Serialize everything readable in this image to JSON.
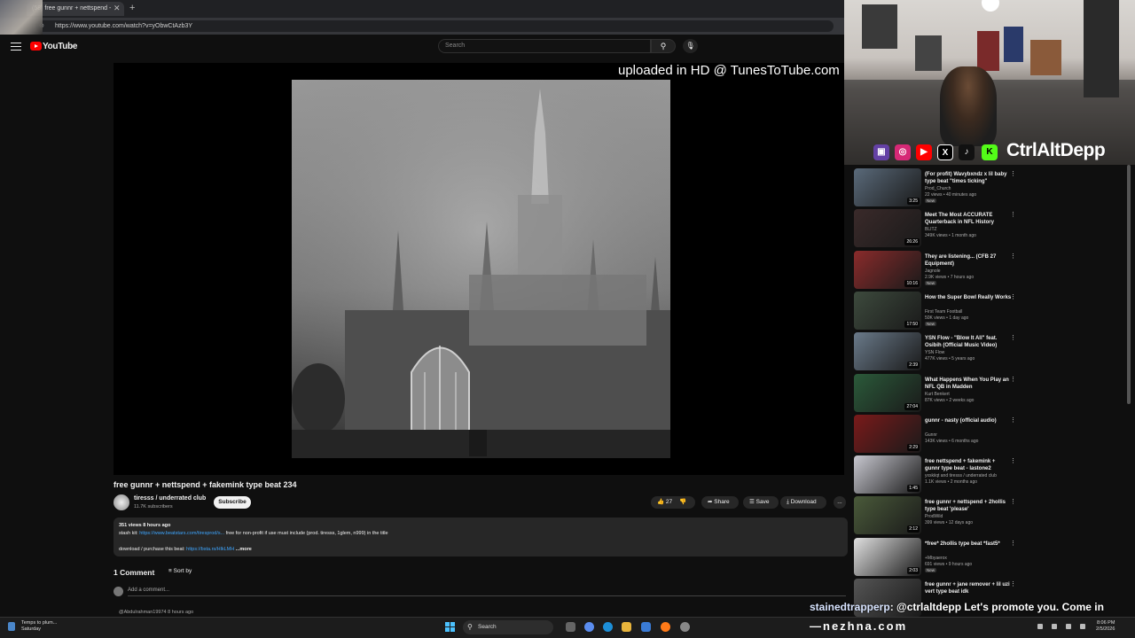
{
  "browser": {
    "tab_title": "(58) free gunnr + nettspend - ",
    "url": "https://www.youtube.com/watch?v=yObwCtAzb3Y"
  },
  "header": {
    "logo_text": "YouTube",
    "search_placeholder": "Search"
  },
  "player": {
    "watermark": "uploaded in HD @ TunesToTube.com"
  },
  "video": {
    "title": "free gunnr + nettspend + fakemink type beat 234",
    "channel_name": "tiresss / underrated club",
    "subscribers": "11.7K subscribers",
    "subscribe_label": "Subscribe",
    "likes": "27",
    "share_label": "Share",
    "save_label": "Save",
    "download_label": "Download",
    "more_label": "...",
    "description": {
      "views_time": "351 views  8 hours ago",
      "line1_prefix": "stash kit: ",
      "line1_link": "https://www.beatstars.com/tiresprod/s...",
      "line1_suffix": " free for non-profit if use must include (prod. tiresss, 1glem, n999) in the title",
      "line2_prefix": "download / purchase this beat: ",
      "line2_link": "https://bsta.rs/HlkLMH",
      "line2_more": " ...more"
    }
  },
  "comments": {
    "count_label": "1 Comment",
    "sort_label": "Sort by",
    "add_placeholder": "Add a comment...",
    "first_comment_author": "@Abdulrahman19974  8 hours ago"
  },
  "stream_overlay": {
    "streamer": "CtrlAltDepp",
    "chat_user": "stainedtrapperp",
    "chat_message": ": @ctrlaltdepp Let's promote you. Come in",
    "site": "—nezhna.com",
    "social_icons": [
      "twitch-icon",
      "instagram-icon",
      "youtube-icon",
      "x-icon",
      "tiktok-icon",
      "kick-icon"
    ]
  },
  "sidebar": {
    "items": [
      {
        "title": "(For profit) Wavybxndz x lil baby type beat \"times ticking\"",
        "channel": "Prod_Church",
        "meta": "22 views • 40 minutes ago",
        "badge": "New",
        "duration": "3:25",
        "thumb": "#5a6a7a"
      },
      {
        "title": "Meet The Most ACCURATE Quarterback in NFL History",
        "channel": "BLITZ",
        "meta": "349K views • 1 month ago",
        "badge": "",
        "duration": "26:26",
        "thumb": "#3a2a2a"
      },
      {
        "title": "They are listening... (CFB 27 Equipment)",
        "channel": "Jagnole",
        "meta": "2.9K views • 7 hours ago",
        "badge": "New",
        "duration": "10:16",
        "thumb": "#8a2b2b"
      },
      {
        "title": "How the Super Bowl Really Works",
        "channel": "First Team Football",
        "meta": "50K views • 1 day ago",
        "badge": "New",
        "duration": "17:50",
        "thumb": "#3d4a3d"
      },
      {
        "title": "YSN Flow - \"Blow It All\" feat. Osibih (Official Music Video)",
        "channel": "YSN Flow",
        "meta": "477K views • 5 years ago",
        "badge": "",
        "duration": "2:39",
        "thumb": "#6a7a8a"
      },
      {
        "title": "What Happens When You Play an NFL QB in Madden",
        "channel": "Kurt Benkert",
        "meta": "87K views • 2 weeks ago",
        "badge": "",
        "duration": "27:04",
        "thumb": "#2b5a3a"
      },
      {
        "title": "gunnr - nasty (official audio)",
        "channel": "Gunnr",
        "meta": "143K views • 6 months ago",
        "badge": "",
        "duration": "2:29",
        "thumb": "#7a1a1a"
      },
      {
        "title": "free nettspend + fakemink + gunnr type beat - lastone2",
        "channel": "yxskiiqt and tiresss / underrated club",
        "meta": "1.1K views • 2 months ago",
        "badge": "",
        "duration": "1:45",
        "thumb": "#c8c8d0"
      },
      {
        "title": "free gunnr + nettspend + 2hollis type beat 'please'",
        "channel": "ProdWild",
        "meta": "399 views • 12 days ago",
        "badge": "",
        "duration": "2:12",
        "thumb": "#4a5a3a"
      },
      {
        "title": "*free* 2hollis type beat *fast5*",
        "channel": "+Mbyaerox",
        "meta": "691 views • 9 hours ago",
        "badge": "New",
        "duration": "2:03",
        "thumb": "#e0e0e0"
      },
      {
        "title": "free gunnr + jane remover + lil uzi vert type beat idk",
        "channel": "",
        "meta": "",
        "badge": "",
        "duration": "",
        "thumb": "#555555"
      }
    ]
  },
  "taskbar": {
    "weather_line1": "Temps to plum...",
    "weather_line2": "Saturday",
    "search_label": "Search",
    "time": "8:06 PM",
    "date": "2/5/2026"
  }
}
